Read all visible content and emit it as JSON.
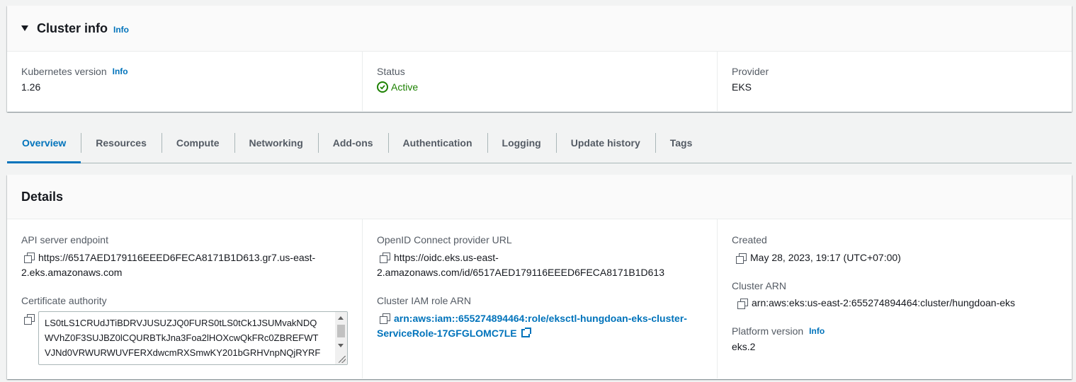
{
  "cluster_info": {
    "title": "Cluster info",
    "info": "Info",
    "kubernetes_version_label": "Kubernetes version",
    "kubernetes_version_info": "Info",
    "kubernetes_version": "1.26",
    "status_label": "Status",
    "status": "Active",
    "provider_label": "Provider",
    "provider": "EKS"
  },
  "tabs": [
    "Overview",
    "Resources",
    "Compute",
    "Networking",
    "Add-ons",
    "Authentication",
    "Logging",
    "Update history",
    "Tags"
  ],
  "details": {
    "title": "Details",
    "api_endpoint_label": "API server endpoint",
    "api_endpoint_line1": "https://6517AED179116EEED6FECA8171B1D613.gr7.us-east-",
    "api_endpoint_line2": "2.eks.amazonaws.com",
    "cert_authority_label": "Certificate authority",
    "cert_authority_text": "LS0tLS1CRUdJTiBDRVJUSUZJQ0FURS0tLS0tCk1JSUMvakNDQ\nWVhZ0F3SUJBZ0lCQURBTkJna3Foa2lHOXcwQkFRc0ZBREFWT\nVJNd0VRWURWUVFERXdwcmRXSmwKY201bGRHVnpNQjRYRF",
    "oidc_label": "OpenID Connect provider URL",
    "oidc_line1": "https://oidc.eks.us-east-",
    "oidc_line2": "2.amazonaws.com/id/6517AED179116EEED6FECA8171B1D613",
    "iam_role_label": "Cluster IAM role ARN",
    "iam_role_line1": "arn:aws:iam::655274894464:role/eksctl-hungdoan-eks-cluster-",
    "iam_role_line2": "ServiceRole-17GFGLOMC7LE",
    "created_label": "Created",
    "created": "May 28, 2023, 19:17 (UTC+07:00)",
    "cluster_arn_label": "Cluster ARN",
    "cluster_arn": "arn:aws:eks:us-east-2:655274894464:cluster/hungdoan-eks",
    "platform_version_label": "Platform version",
    "platform_version_info": "Info",
    "platform_version": "eks.2"
  },
  "colors": {
    "link": "#0073bb",
    "success": "#1d8102",
    "text": "#16191f",
    "label": "#545b64"
  }
}
